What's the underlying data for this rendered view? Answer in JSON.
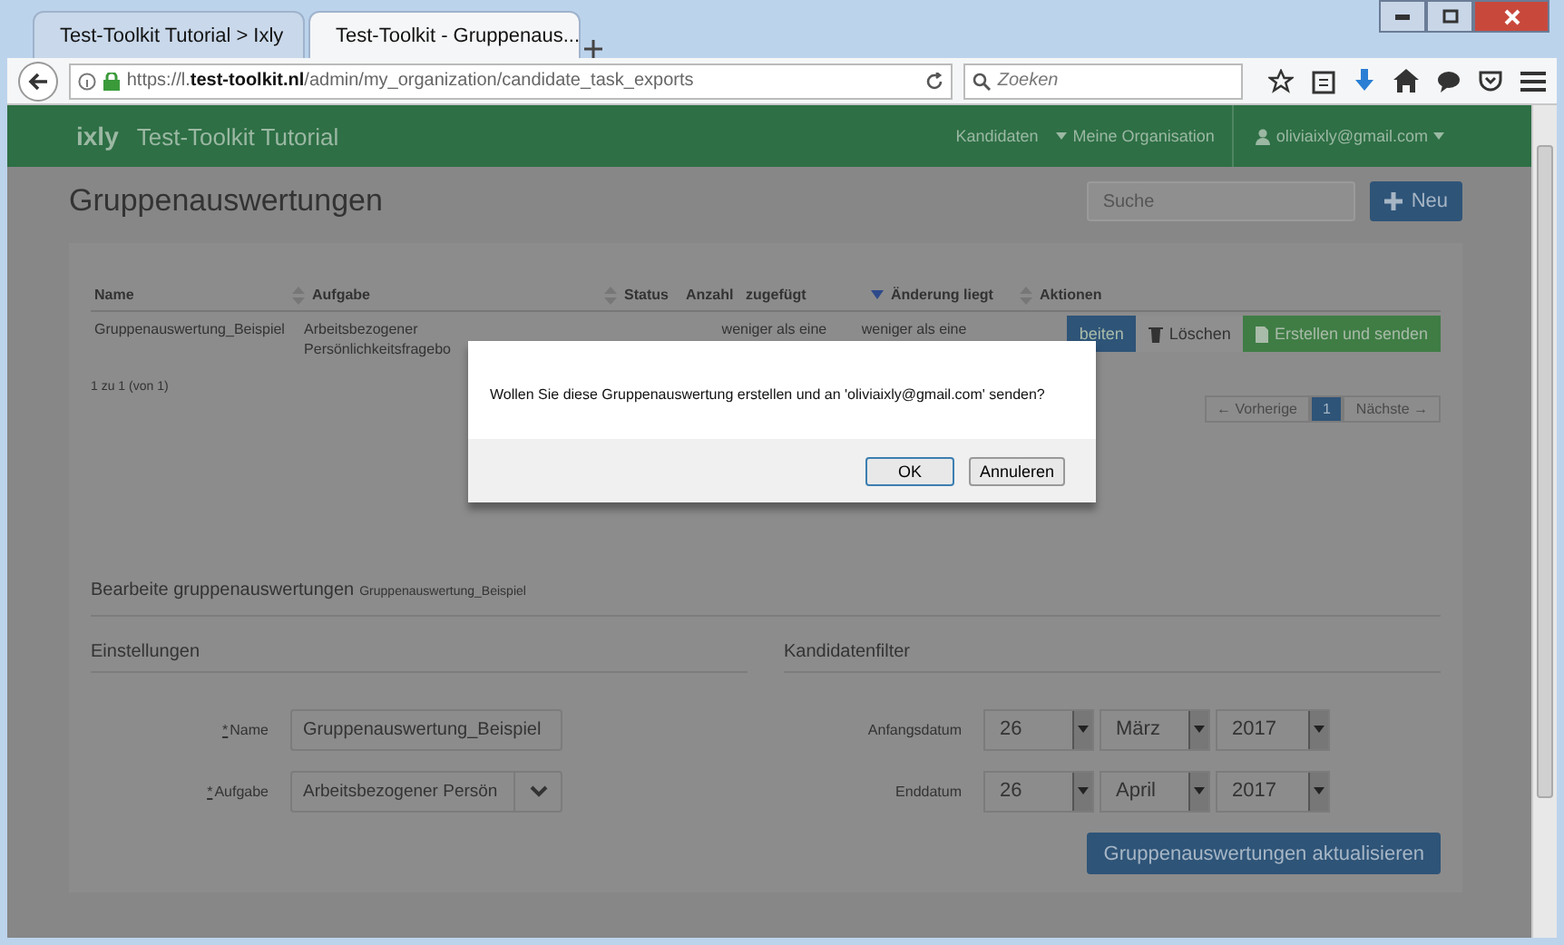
{
  "browser": {
    "tabs": [
      {
        "title": "Test-Toolkit Tutorial > Ixly",
        "selected": false
      },
      {
        "title": "Test-Toolkit - Gruppenaus...",
        "selected": true
      }
    ],
    "url": {
      "prefix": "https://l.",
      "host": "test-toolkit.nl",
      "path": "/admin/my_organization/candidate_task_exports"
    },
    "search_placeholder": "Zoeken"
  },
  "app": {
    "brand": "ixly",
    "title": "Test-Toolkit Tutorial",
    "nav": [
      {
        "label": "Kandidaten",
        "caret": false
      },
      {
        "label": "Meine Organisation",
        "caret": true
      }
    ],
    "user": "oliviaixly@gmail.com"
  },
  "page": {
    "title": "Gruppenauswertungen",
    "search_placeholder": "Suche",
    "new_button": "Neu"
  },
  "table": {
    "columns": [
      {
        "label": "Name",
        "sortable": true,
        "sorted": false
      },
      {
        "label": "Aufgabe",
        "sortable": true,
        "sorted": false
      },
      {
        "label": "Status",
        "sortable": false
      },
      {
        "label": "Anzahl",
        "sortable": false
      },
      {
        "label": "zugefügt",
        "sortable": true,
        "sorted": true
      },
      {
        "label": "Änderung liegt",
        "sortable": true,
        "sorted": false
      },
      {
        "label": "Aktionen",
        "sortable": false
      }
    ],
    "rows": [
      {
        "cells": [
          [
            "Gruppenauswertung_Beispiel"
          ],
          [
            "Arbeitsbezogener",
            "Persönlichkeitsfragebo"
          ],
          [],
          [],
          [
            "weniger als eine"
          ],
          [
            "weniger als eine"
          ]
        ],
        "actions": [
          {
            "label": "beiten",
            "kind": "primary"
          },
          {
            "label": "Löschen",
            "kind": "default"
          },
          {
            "label": "Erstellen und senden",
            "kind": "success"
          }
        ]
      }
    ]
  },
  "pagination": {
    "summary": "1 zu 1 (von 1)",
    "prev": "← Vorherige",
    "pages": [
      {
        "label": "1",
        "selected": true
      }
    ],
    "next": "Nächste →"
  },
  "edit": {
    "heading": "Bearbeite gruppenauswertungen",
    "subject": "Gruppenauswertung_Beispiel",
    "settings": {
      "heading": "Einstellungen",
      "fields": [
        {
          "label": "Name",
          "required_mark": "*",
          "kind": "text",
          "value": "Gruppenauswertung_Beispiel"
        },
        {
          "label": "Aufgabe",
          "required_mark": "*",
          "kind": "select",
          "value": "Arbeitsbezogener Persön"
        }
      ]
    },
    "filter": {
      "heading": "Kandidatenfilter",
      "dates": [
        {
          "label": "Anfangsdatum",
          "parts": [
            "26",
            "März",
            "2017"
          ]
        },
        {
          "label": "Enddatum",
          "parts": [
            "26",
            "April",
            "2017"
          ]
        }
      ]
    },
    "submit": "Gruppenauswertungen aktualisieren"
  },
  "dialog": {
    "message": "Wollen Sie diese Gruppenauswertung erstellen und an 'oliviaixly@gmail.com' senden?",
    "buttons": [
      {
        "label": "OK",
        "default": true
      },
      {
        "label": "Annuleren",
        "default": false
      }
    ]
  }
}
